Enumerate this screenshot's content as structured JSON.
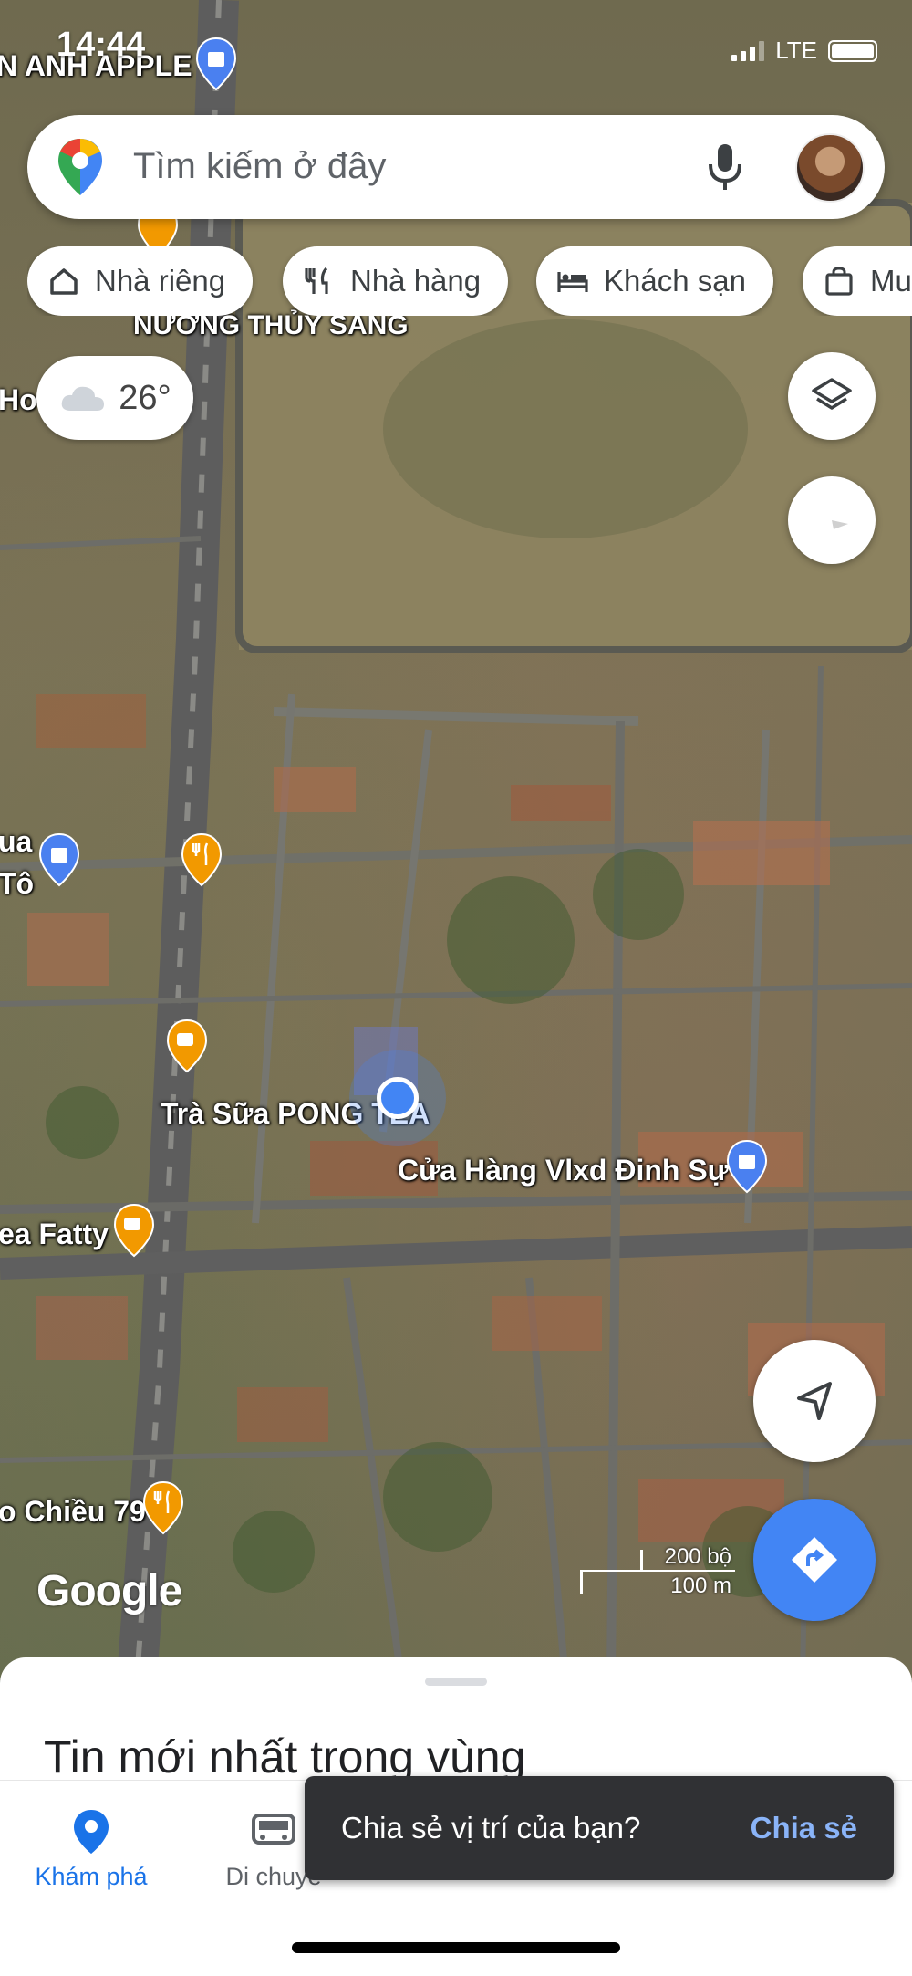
{
  "status_bar": {
    "time": "14:44",
    "network": "LTE"
  },
  "search": {
    "placeholder": "Tìm kiếm ở đây"
  },
  "chips": [
    {
      "label": "Nhà riêng",
      "icon": "home-icon"
    },
    {
      "label": "Nhà hàng",
      "icon": "restaurant-icon"
    },
    {
      "label": "Khách sạn",
      "icon": "hotel-icon"
    },
    {
      "label": "Mu",
      "icon": "shopping-bag-icon"
    }
  ],
  "weather": {
    "temp": "26°",
    "icon": "cloud-icon"
  },
  "map_labels": {
    "anh_apple": "N ANH APPLE",
    "nuong": "NƯỚNG THỦY SANG",
    "ho": "Ho",
    "qua": "ua",
    "to": "Tô",
    "tra_sua": "Trà Sữa PONG TEA",
    "cua_hang": "Cửa Hàng Vlxd Đinh Sự",
    "tea_fatty": "ea Fatty",
    "chieu": "o Chiều 79"
  },
  "map": {
    "attribution": "Google",
    "scale_top": "200 bộ",
    "scale_bottom": "100 m",
    "brand_blue": "#4285f4"
  },
  "sheet": {
    "title": "Tin mới nhất trong vùng"
  },
  "nav": {
    "explore": "Khám phá",
    "commute": "Di chuyể"
  },
  "snackbar": {
    "text": "Chia sẻ vị trí của bạn?",
    "action": "Chia sẻ"
  }
}
